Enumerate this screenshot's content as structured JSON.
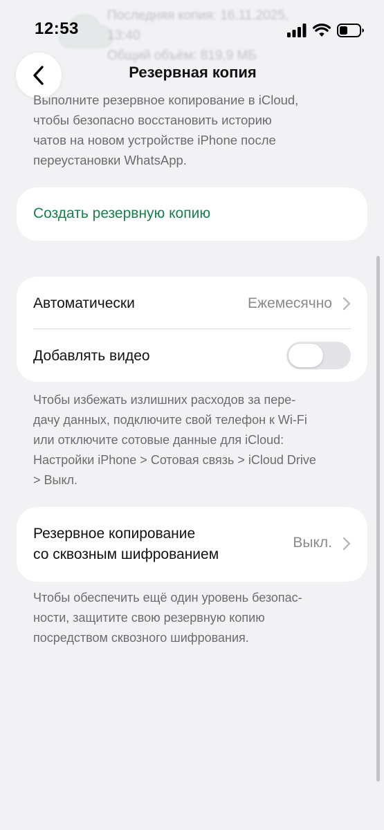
{
  "status_bar": {
    "time": "12:53",
    "icons": [
      "signal-icon",
      "wifi-icon",
      "battery-icon"
    ]
  },
  "behind": {
    "line1": "Последняя копия: 16.11.2025,",
    "line2": "13:40",
    "line3": "Общий объём: 819,9 МБ"
  },
  "nav": {
    "back_icon": "chevron-left-icon",
    "title": "Резервная копия"
  },
  "intro": {
    "line1": "Выполните резервное копирование в iCloud,",
    "line2": "чтобы безопасно восстановить историю",
    "line3": "чатов на новом устройстве iPhone после",
    "line4": "переустановки WhatsApp."
  },
  "create_backup": {
    "label": "Создать резервную копию"
  },
  "settings": {
    "auto": {
      "label": "Автоматически",
      "value": "Ежемесячно"
    },
    "video": {
      "label": "Добавлять видео",
      "toggle_on": false
    }
  },
  "note_cellular": {
    "line1": "Чтобы избежать излишних расходов за пере-",
    "line2": "дачу данных, подключите свой телефон к Wi-Fi",
    "line3": "или отключите сотовые данные для iCloud:",
    "line4": "Настройки iPhone > Сотовая связь > iCloud Drive",
    "line5": "> Выкл."
  },
  "e2e": {
    "label_line1": "Резервное копирование",
    "label_line2": "со сквозным шифрованием",
    "value": "Выкл."
  },
  "note_e2e": {
    "line1": "Чтобы обеспечить ещё один уровень безопас-",
    "line2": "ности, защитите свою резервную копию",
    "line3": "посредством сквозного шифрования."
  },
  "colors": {
    "accent_green": "#1a7f4b",
    "background": "#f2f2f4",
    "secondary_text": "#6b6b70"
  }
}
